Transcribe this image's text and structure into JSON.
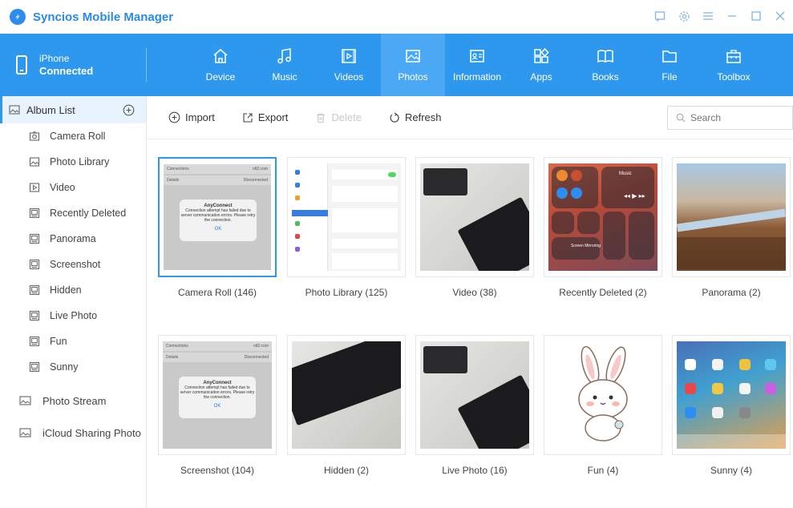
{
  "app": {
    "title": "Syncios Mobile Manager"
  },
  "window_controls": [
    "feedback-icon",
    "settings-icon",
    "menu-icon",
    "minimize-icon",
    "maximize-icon",
    "close-icon"
  ],
  "device": {
    "name": "iPhone",
    "status": "Connected"
  },
  "nav_tabs": [
    {
      "label": "Device",
      "icon": "home-icon"
    },
    {
      "label": "Music",
      "icon": "music-icon"
    },
    {
      "label": "Videos",
      "icon": "video-icon"
    },
    {
      "label": "Photos",
      "icon": "photo-icon",
      "active": true
    },
    {
      "label": "Information",
      "icon": "contact-icon"
    },
    {
      "label": "Apps",
      "icon": "apps-icon"
    },
    {
      "label": "Books",
      "icon": "book-icon"
    },
    {
      "label": "File",
      "icon": "folder-icon"
    },
    {
      "label": "Toolbox",
      "icon": "toolbox-icon"
    }
  ],
  "sidebar": {
    "header": "Album List",
    "albums": [
      {
        "label": "Camera Roll",
        "icon": "camera-icon"
      },
      {
        "label": "Photo Library",
        "icon": "image-icon"
      },
      {
        "label": "Video",
        "icon": "play-icon"
      },
      {
        "label": "Recently Deleted",
        "icon": "album-icon"
      },
      {
        "label": "Panorama",
        "icon": "album-icon"
      },
      {
        "label": "Screenshot",
        "icon": "album-icon"
      },
      {
        "label": "Hidden",
        "icon": "album-icon"
      },
      {
        "label": "Live Photo",
        "icon": "album-icon"
      },
      {
        "label": "Fun",
        "icon": "album-icon"
      },
      {
        "label": "Sunny",
        "icon": "album-icon"
      }
    ],
    "photo_stream": "Photo Stream",
    "icloud": "iCloud Sharing Photo"
  },
  "toolbar": {
    "import": "Import",
    "export": "Export",
    "delete": "Delete",
    "refresh": "Refresh",
    "search_placeholder": "Search"
  },
  "albums_grid": [
    {
      "caption": "Camera Roll (146)",
      "thumb": "dialog",
      "selected": true
    },
    {
      "caption": "Photo Library (125)",
      "thumb": "settings"
    },
    {
      "caption": "Video (38)",
      "thumb": "desk"
    },
    {
      "caption": "Recently Deleted (2)",
      "thumb": "control-center"
    },
    {
      "caption": "Panorama (2)",
      "thumb": "panorama"
    },
    {
      "caption": "Screenshot (104)",
      "thumb": "dialog"
    },
    {
      "caption": "Hidden (2)",
      "thumb": "keyboard"
    },
    {
      "caption": "Live Photo (16)",
      "thumb": "desk"
    },
    {
      "caption": "Fun (4)",
      "thumb": "bunny"
    },
    {
      "caption": "Sunny (4)",
      "thumb": "ipad"
    }
  ],
  "dialog_thumb": {
    "connections": "Connections",
    "connections_value": "nlt2.com",
    "details": "Details",
    "details_value": "Disconnected",
    "title": "AnyConnect",
    "message": "Connection attempt has failed due to server communication errors. Please retry the connection.",
    "ok": "OK"
  },
  "colors": {
    "accent": "#2e97ee",
    "title": "#2a8ae6"
  }
}
